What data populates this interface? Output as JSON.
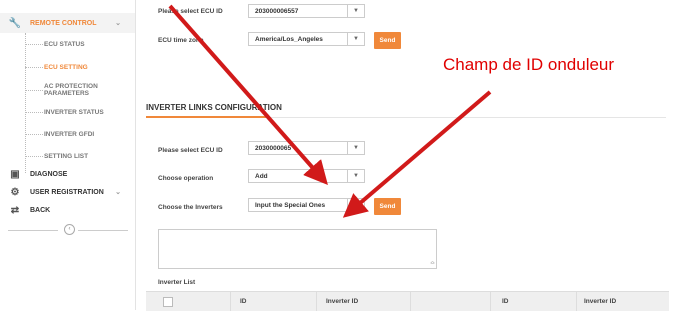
{
  "sidebar": {
    "items": [
      {
        "label": "REMOTE CONTROL",
        "icon": "wrench-icon",
        "active": true
      },
      {
        "label": "DIAGNOSE",
        "icon": "briefcase-icon"
      },
      {
        "label": "USER REGISTRATION",
        "icon": "gears-icon"
      },
      {
        "label": "BACK",
        "icon": "exit-icon"
      }
    ],
    "subitems": [
      {
        "label": "ECU STATUS"
      },
      {
        "label": "ECU SETTING",
        "selected": true
      },
      {
        "label": "AC PROTECTION PARAMETERS"
      },
      {
        "label": "INVERTER STATUS"
      },
      {
        "label": "INVERTER GFDI"
      },
      {
        "label": "SETTING LIST"
      }
    ],
    "collapse_glyph": "‹"
  },
  "ecu_setting": {
    "select_label": "Please select ECU ID",
    "select_value": "203000006557",
    "timezone_label": "ECU time zone",
    "timezone_value": "America/Los_Angeles",
    "send_label": "Send"
  },
  "inverter_links": {
    "title": "INVERTER LINKS CONFIGURATION",
    "ecu_label": "Please select ECU ID",
    "ecu_value": "2030000065",
    "operation_label": "Choose operation",
    "operation_value": "Add",
    "inverters_label": "Choose the Inverters",
    "inverters_value": "Input the Special Ones",
    "send_label": "Send",
    "textarea_value": "",
    "list_label": "Inverter List",
    "table_headers": [
      "ID",
      "Inverter ID",
      "",
      "ID",
      "Inverter ID"
    ]
  },
  "annotation": {
    "text": "Champ de ID onduleur",
    "color": "#e00000"
  },
  "colors": {
    "accent": "#f0883a",
    "annotation": "#d11a1a"
  }
}
